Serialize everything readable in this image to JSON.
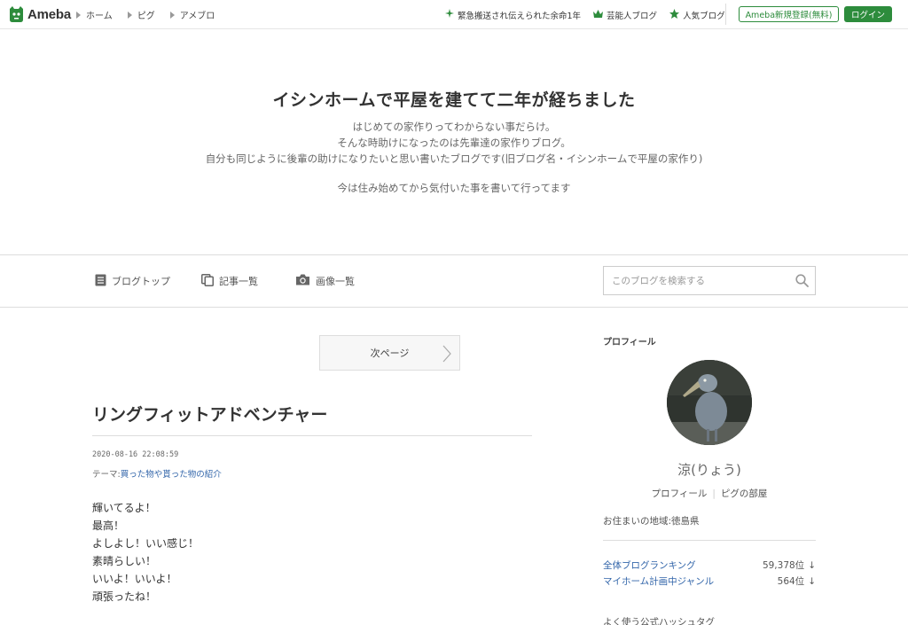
{
  "topbar": {
    "logo_text": "Ameba",
    "nav": [
      "ホーム",
      "ピグ",
      "アメブロ"
    ],
    "links": [
      {
        "label": "緊急搬送され伝えられた余命1年",
        "icon": "sparkle-icon"
      },
      {
        "label": "芸能人ブログ",
        "icon": "crown-icon"
      },
      {
        "label": "人気ブログ",
        "icon": "star-icon"
      }
    ],
    "register_label": "Ameba新規登録(無料)",
    "login_label": "ログイン",
    "brand_color": "#2d8c3c"
  },
  "header": {
    "title": "イシンホームで平屋を建てて二年が経ちました",
    "description_lines": [
      "はじめての家作りってわからない事だらけ。",
      "そんな時助けになったのは先輩達の家作りブログ。",
      "自分も同じように後輩の助けになりたいと思い書いたブログです(旧ブログ名・イシンホームで平屋の家作り)"
    ],
    "description_extra": "今は住み始めてから気付いた事を書いて行ってます"
  },
  "navbar": {
    "items": [
      {
        "label": "ブログトップ",
        "icon": "document-icon"
      },
      {
        "label": "記事一覧",
        "icon": "copy-icon"
      },
      {
        "label": "画像一覧",
        "icon": "camera-icon"
      }
    ],
    "search_placeholder": "このブログを検索する"
  },
  "main": {
    "next_page_label": "次ページ",
    "entry": {
      "title": "リングフィットアドベンチャー",
      "date": "2020-08-16 22:08:59",
      "theme_prefix": "テーマ:",
      "theme": "買った物や貰った物の紹介",
      "body_lines": [
        "輝いてるよ！",
        "最高！",
        "よしよし！いい感じ！",
        "素晴らしい！",
        "いいよ！いいよ！",
        "頑張ったね！"
      ]
    }
  },
  "sidebar": {
    "heading": "プロフィール",
    "name": "涼(りょう)",
    "links": [
      "プロフィール",
      "ピグの部屋"
    ],
    "residence": "お住まいの地域:徳島県",
    "rankings": [
      {
        "label": "全体ブログランキング",
        "value": "59,378位",
        "trend": "↓"
      },
      {
        "label": "マイホーム計画中ジャンル",
        "value": "564位",
        "trend": "↓"
      }
    ],
    "hashtag_heading": "よく使う公式ハッシュタグ"
  }
}
